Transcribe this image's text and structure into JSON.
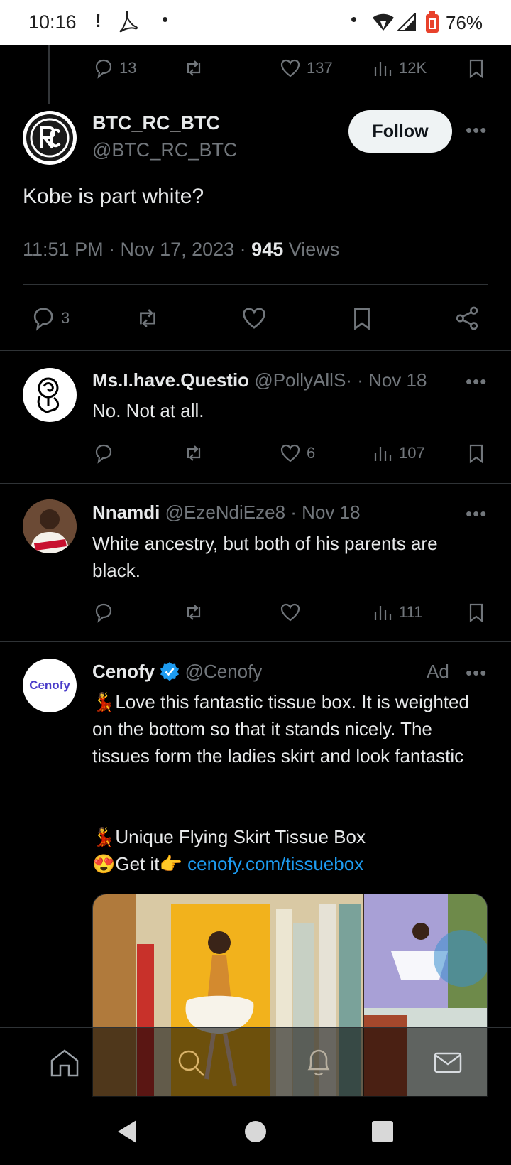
{
  "status_bar": {
    "time": "10:16",
    "battery": "76%",
    "icons": [
      "alert-icon",
      "pdf-icon",
      "dot-icon",
      "dot-icon",
      "wifi-icon",
      "signal-icon",
      "battery-icon"
    ]
  },
  "prev_tweet_actions": {
    "replies": "13",
    "likes": "137",
    "views": "12K"
  },
  "main_tweet": {
    "display_name": "BTC_RC_BTC",
    "handle": "@BTC_RC_BTC",
    "follow_label": "Follow",
    "text": "Kobe is part white?",
    "timestamp": "11:51 PM · Nov 17, 2023 · ",
    "views_count": "945",
    "views_label": " Views",
    "replies": "3"
  },
  "replies": [
    {
      "display_name": "Ms.I.have.Questio",
      "handle": "@PollyAllS·",
      "date": " · Nov 18",
      "text": "No. Not at all.",
      "likes": "6",
      "views": "107"
    },
    {
      "display_name": "Nnamdi",
      "handle": "@EzeNdiEze8",
      "date": " · Nov 18",
      "text": "White ancestry, but both of his parents are black.",
      "views": "111"
    }
  ],
  "ad": {
    "display_name": "Cenofy",
    "handle": "@Cenofy",
    "ad_label": "Ad",
    "avatar_text": "Cenofy",
    "line1": "💃Love this fantastic tissue box. It is weighted on the bottom so that it stands nicely. The tissues form the ladies skirt and look fantastic",
    "line2": "💃Unique Flying Skirt Tissue Box",
    "line3_prefix": "😍Get it👉 ",
    "link": "cenofy.com/tissuebox"
  },
  "colors": {
    "accent": "#1d9bf0",
    "background": "#000000",
    "muted": "#71767b",
    "verified": "#1d9bf0"
  }
}
